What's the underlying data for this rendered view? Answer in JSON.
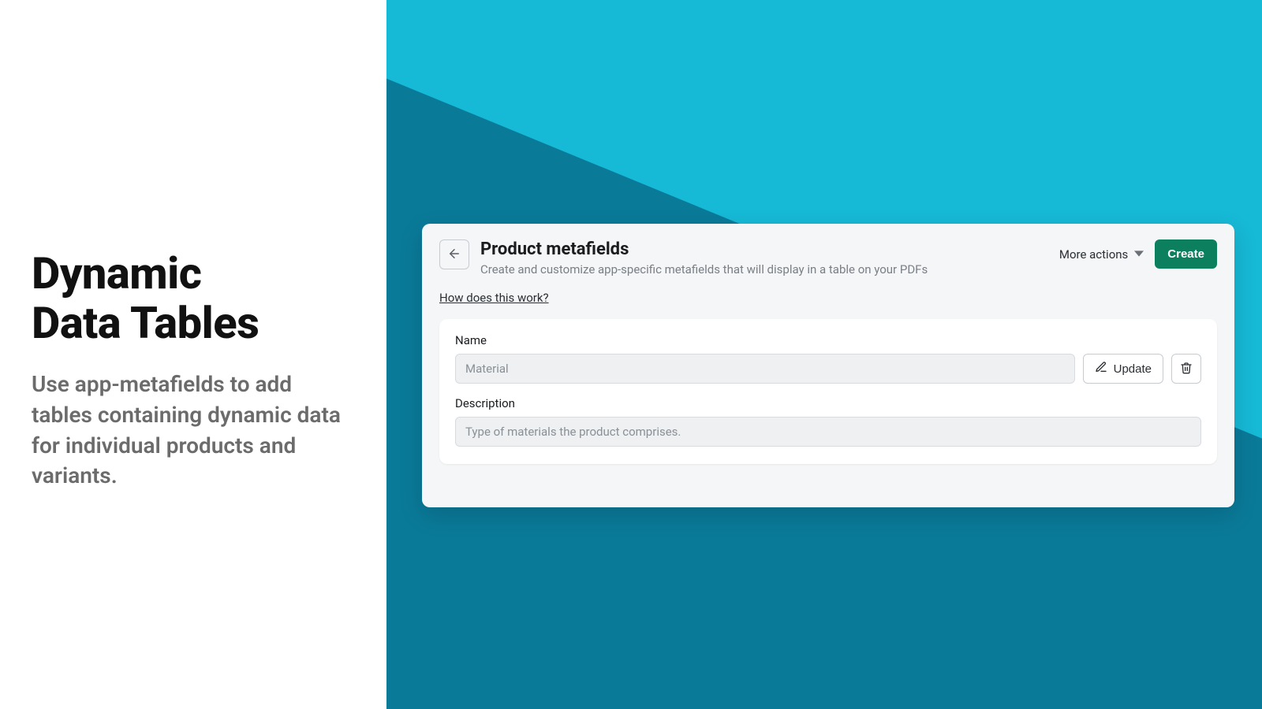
{
  "left": {
    "title_line1": "Dynamic",
    "title_line2": "Data Tables",
    "subtext": "Use app-metafields to add tables containing dynamic data for individual products and variants."
  },
  "app": {
    "title": "Product metafields",
    "subtitle": "Create and customize app-specific metafields that will display in a table on your PDFs",
    "more_actions_label": "More actions",
    "create_label": "Create",
    "how_link": "How does this work?",
    "card": {
      "name_label": "Name",
      "name_placeholder": "Material",
      "update_label": "Update",
      "description_label": "Description",
      "description_placeholder": "Type of materials the product comprises."
    }
  },
  "colors": {
    "teal_dark": "#0a7a99",
    "teal_light": "#16b9d6",
    "panel": "#f5f6f7",
    "btn_primary": "#0c805e"
  }
}
